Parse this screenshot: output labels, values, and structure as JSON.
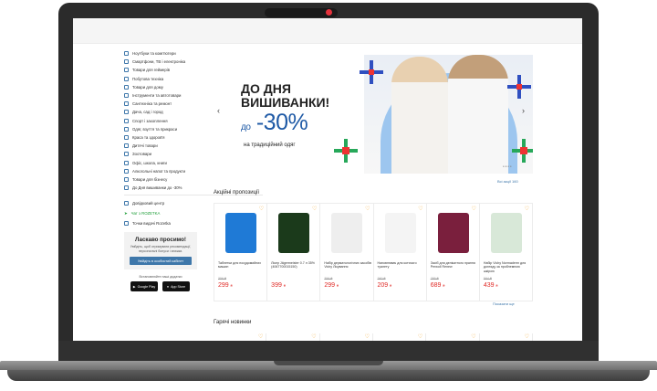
{
  "sidebar": {
    "categories": [
      "Ноутбуки та комп'ютери",
      "Смартфони, ТВ і електроніка",
      "Товари для геймерів",
      "Побутова техніка",
      "Товари для дому",
      "Інструменти та автотовари",
      "Сантехніка та ремонт",
      "Дача, сад і город",
      "Спорт і захоплення",
      "Одяг, взуття та прикраси",
      "Краса та здоров'я",
      "Дитячі товари",
      "Зоотовари",
      "Офіс, школа, книги",
      "Алкогольні напої та продукти",
      "Товари для бізнесу",
      "До Дня вишиванки до -30%"
    ],
    "extras": [
      "Довідковий центр",
      "Чат з ROZETKA",
      "Точки видачі Rozetka"
    ]
  },
  "welcome": {
    "title": "Ласкаво просимо!",
    "text": "Увійдіть, щоб отримувати рекомендації, персональні бонуси і знижки.",
    "button": "Увійдіть в особистий кабінет"
  },
  "apps": {
    "title": "Встановлюйте наші додатки",
    "google": "Google Play",
    "apple": "App Store"
  },
  "banner": {
    "title_line1": "ДО ДНЯ",
    "title_line2": "ВИШИВАНКИ!",
    "pct_prefix": "до",
    "pct": "-30%",
    "subtitle": "на традиційний одяг"
  },
  "all_promos": "Всі акції 160",
  "sections": {
    "promo": "Акційні пропозиції",
    "new": "Гарячі новинки"
  },
  "products": [
    {
      "name": "Таблетки для посудомийних машин",
      "old": "356 ₴",
      "price": "299",
      "currency": "₴"
    },
    {
      "name": "Лікер Jägermeister 0.7 л 35% (4067700015150)",
      "old": "",
      "price": "399",
      "currency": "₴"
    },
    {
      "name": "Набір дерматологічних засобів Vichy Лікування",
      "old": "356 ₴",
      "price": "299",
      "currency": "₴"
    },
    {
      "name": "Наповнювач для котячого туалету",
      "old": "260 ₴",
      "price": "209",
      "currency": "₴"
    },
    {
      "name": "Засіб для делікатного прання Perwoll Renew",
      "old": "785 ₴",
      "price": "689",
      "currency": "₴"
    },
    {
      "name": "Набір Vichy Normaderm для догляду за проблемною шкірою",
      "old": "584 ₴",
      "price": "439",
      "currency": "₴"
    }
  ],
  "show_more": "Показати ще"
}
